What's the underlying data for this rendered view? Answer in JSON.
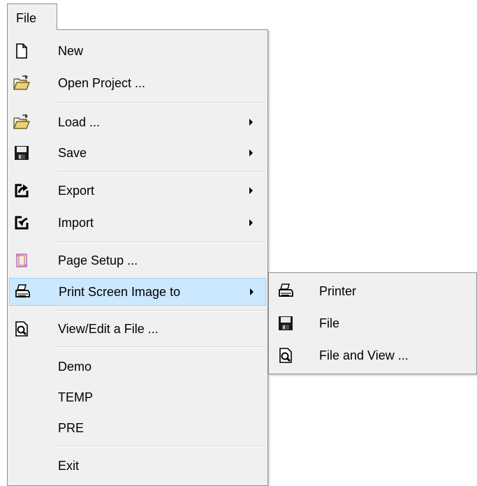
{
  "menubar": {
    "file_label": "File"
  },
  "menu": {
    "items": {
      "new": {
        "label": "New",
        "icon": "new-document-icon"
      },
      "open_project": {
        "label": "Open Project ...",
        "icon": "open-folder-icon"
      },
      "load": {
        "label": "Load ...",
        "icon": "open-folder-icon",
        "has_submenu": true
      },
      "save": {
        "label": "Save",
        "icon": "floppy-disk-icon",
        "has_submenu": true
      },
      "export": {
        "label": "Export",
        "icon": "export-icon",
        "has_submenu": true
      },
      "import": {
        "label": "Import",
        "icon": "import-icon",
        "has_submenu": true
      },
      "page_setup": {
        "label": "Page Setup ...",
        "icon": "page-setup-icon"
      },
      "print_screen": {
        "label": "Print Screen Image to",
        "icon": "printer-icon",
        "has_submenu": true,
        "highlighted": true
      },
      "view_edit": {
        "label": "View/Edit a File ...",
        "icon": "preview-icon"
      },
      "demo": {
        "label": "Demo"
      },
      "temp": {
        "label": "TEMP"
      },
      "pre": {
        "label": "PRE"
      },
      "exit": {
        "label": "Exit"
      }
    }
  },
  "submenu": {
    "items": {
      "printer": {
        "label": "Printer",
        "icon": "printer-icon"
      },
      "file": {
        "label": "File",
        "icon": "floppy-disk-icon"
      },
      "file_and_view": {
        "label": "File and View ...",
        "icon": "preview-icon"
      }
    }
  },
  "colors": {
    "menu_bg": "#f0f0f0",
    "highlight_bg": "#cce8ff",
    "highlight_border": "#99d1ff",
    "border": "#8f8f8f"
  }
}
